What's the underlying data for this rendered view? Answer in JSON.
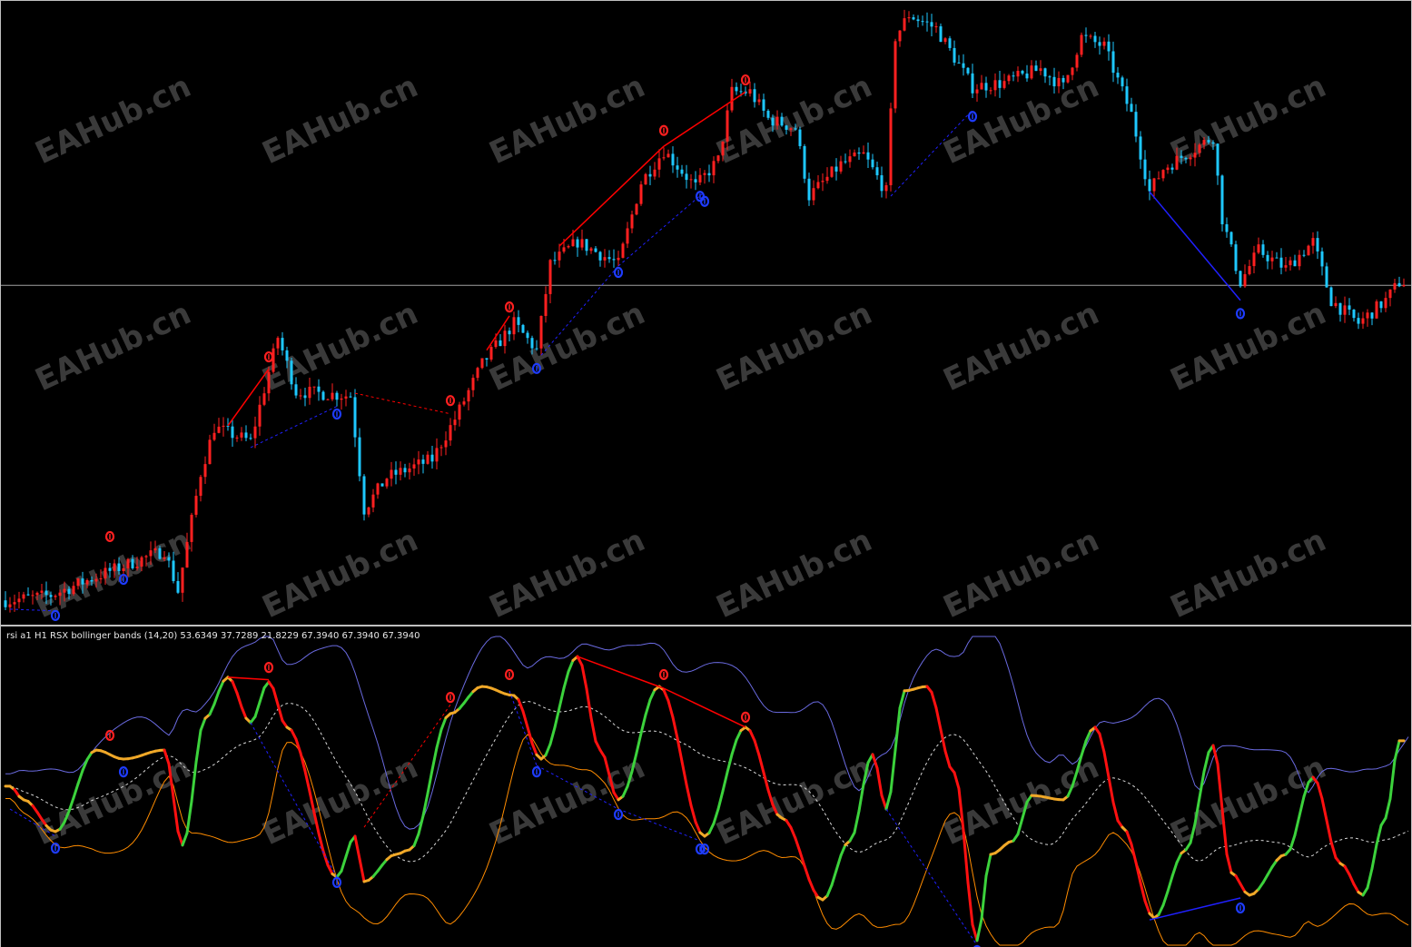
{
  "chart_data": [
    {
      "type": "candlestick",
      "title": "",
      "symbol_timeframe": "H1",
      "price_scale_note": "relative 0-100 (no axis shown)",
      "up_color": "#ff2020",
      "down_color": "#1ec8ff",
      "bars": 310,
      "close_path": [
        [
          1,
          3.9
        ],
        [
          10,
          4.7
        ],
        [
          22,
          8.3
        ],
        [
          35,
          11.9
        ],
        [
          38,
          5.4
        ],
        [
          43,
          24.3
        ],
        [
          46,
          31.6
        ],
        [
          54,
          29.4
        ],
        [
          60,
          46.1
        ],
        [
          64,
          37.4
        ],
        [
          76,
          36.7
        ],
        [
          79,
          18.5
        ],
        [
          84,
          23.6
        ],
        [
          94,
          26.5
        ],
        [
          99,
          33.0
        ],
        [
          105,
          41.8
        ],
        [
          112,
          48.3
        ],
        [
          117,
          44.0
        ],
        [
          120,
          57.8
        ],
        [
          126,
          61.4
        ],
        [
          135,
          57.8
        ],
        [
          140,
          70.9
        ],
        [
          145,
          76.0
        ],
        [
          152,
          70.2
        ],
        [
          157,
          74.5
        ],
        [
          160,
          85.4
        ],
        [
          164,
          85.4
        ],
        [
          168,
          81.1
        ],
        [
          174,
          79.6
        ],
        [
          177,
          68.7
        ],
        [
          184,
          73.8
        ],
        [
          189,
          75.3
        ],
        [
          194,
          69.4
        ],
        [
          196,
          94.2
        ],
        [
          199,
          97.8
        ],
        [
          205,
          95.6
        ],
        [
          213,
          86.2
        ],
        [
          220,
          86.9
        ],
        [
          228,
          89.1
        ],
        [
          233,
          86.2
        ],
        [
          237,
          94.2
        ],
        [
          242,
          92.7
        ],
        [
          248,
          81.8
        ],
        [
          252,
          69.4
        ],
        [
          255,
          73.1
        ],
        [
          266,
          78.2
        ],
        [
          268,
          65.1
        ],
        [
          272,
          54.9
        ],
        [
          276,
          60.0
        ],
        [
          282,
          57.1
        ],
        [
          288,
          61.4
        ],
        [
          292,
          52.0
        ],
        [
          298,
          48.3
        ],
        [
          304,
          52.0
        ],
        [
          307,
          54.9
        ]
      ],
      "horizontal_line": 54.4,
      "divergence_lines": [
        {
          "color": "#ff0000",
          "style": "solid",
          "from": [
            49,
            31.9
          ],
          "to": [
            58,
            41.0
          ]
        },
        {
          "color": "#ff0000",
          "style": "solid",
          "from": [
            106,
            44.0
          ],
          "to": [
            111,
            49.5
          ]
        },
        {
          "color": "#ff0000",
          "style": "solid",
          "from": [
            122,
            60.7
          ],
          "to": [
            145,
            76.7
          ]
        },
        {
          "color": "#ff0000",
          "style": "solid",
          "from": [
            145,
            76.7
          ],
          "to": [
            163,
            85.4
          ]
        },
        {
          "color": "#ff0000",
          "style": "dashed",
          "from": [
            77,
            37.1
          ],
          "to": [
            98,
            33.8
          ]
        },
        {
          "color": "#2020ff",
          "style": "dashed",
          "from": [
            1,
            2.5
          ],
          "to": [
            11,
            2.2
          ]
        },
        {
          "color": "#2020ff",
          "style": "dashed",
          "from": [
            54,
            28.4
          ],
          "to": [
            73,
            35.0
          ]
        },
        {
          "color": "#2020ff",
          "style": "dashed",
          "from": [
            118,
            43.2
          ],
          "to": [
            135,
            57.5
          ]
        },
        {
          "color": "#2020ff",
          "style": "dashed",
          "from": [
            135,
            57.5
          ],
          "to": [
            154,
            69.4
          ]
        },
        {
          "color": "#2020ff",
          "style": "dashed",
          "from": [
            195,
            68.7
          ],
          "to": [
            213,
            82.5
          ]
        },
        {
          "color": "#2020ff",
          "style": "solid",
          "from": [
            252,
            69.4
          ],
          "to": [
            272,
            52.0
          ]
        }
      ],
      "sell_markers": [
        [
          23,
          13.4
        ],
        [
          58,
          42.2
        ],
        [
          98,
          35.2
        ],
        [
          111,
          50.2
        ],
        [
          145,
          78.5
        ],
        [
          163,
          86.6
        ]
      ],
      "buy_markers": [
        [
          11,
          2.2
        ],
        [
          26,
          8.0
        ],
        [
          73,
          34.5
        ],
        [
          117,
          41.8
        ],
        [
          135,
          57.2
        ],
        [
          153,
          69.4
        ],
        [
          154,
          68.6
        ],
        [
          213,
          82.2
        ],
        [
          272,
          50.6
        ]
      ]
    },
    {
      "type": "line",
      "title": "rsi a1 H1 RSX bollinger bands (14,20) 53.6349 37.7289 21.8229 67.3940 67.3940 67.3940",
      "ylim": [
        0,
        100
      ],
      "colors": {
        "up": "#3cd23c",
        "down": "#ff1010",
        "flat": "#f0a828",
        "upper_band": "#6a6ae0",
        "middle_band": "#d8d8d8",
        "lower_band": "#ff8c00"
      },
      "rsx_path": [
        [
          1,
          51.5
        ],
        [
          4,
          47.1
        ],
        [
          11,
          36.8
        ],
        [
          20,
          63.2
        ],
        [
          26,
          60.3
        ],
        [
          35,
          63.2
        ],
        [
          39,
          32.4
        ],
        [
          44,
          73.5
        ],
        [
          49,
          86.8
        ],
        [
          54,
          72.1
        ],
        [
          58,
          85.3
        ],
        [
          62,
          70.6
        ],
        [
          73,
          22.1
        ],
        [
          77,
          35.3
        ],
        [
          79,
          20.6
        ],
        [
          86,
          29.4
        ],
        [
          89,
          30.9
        ],
        [
          98,
          75.0
        ],
        [
          105,
          83.8
        ],
        [
          112,
          80.9
        ],
        [
          118,
          60.3
        ],
        [
          126,
          93.5
        ],
        [
          131,
          63.2
        ],
        [
          135,
          47.1
        ],
        [
          144,
          83.8
        ],
        [
          154,
          35.3
        ],
        [
          163,
          70.6
        ],
        [
          171,
          41.2
        ],
        [
          180,
          14.7
        ],
        [
          186,
          33.8
        ],
        [
          191,
          61.8
        ],
        [
          194,
          44.1
        ],
        [
          198,
          82.4
        ],
        [
          203,
          83.8
        ],
        [
          209,
          55.9
        ],
        [
          214,
          1.5
        ],
        [
          217,
          29.4
        ],
        [
          222,
          33.8
        ],
        [
          226,
          48.5
        ],
        [
          233,
          47.1
        ],
        [
          240,
          70.6
        ],
        [
          246,
          38.2
        ],
        [
          253,
          8.8
        ],
        [
          260,
          30.9
        ],
        [
          266,
          64.7
        ],
        [
          270,
          23.5
        ],
        [
          274,
          16.2
        ],
        [
          282,
          29.4
        ],
        [
          288,
          54.4
        ],
        [
          294,
          26.5
        ],
        [
          299,
          16.2
        ],
        [
          304,
          41.2
        ],
        [
          307,
          66.2
        ]
      ],
      "divergence_lines": [
        {
          "color": "#ff0000",
          "style": "solid",
          "from": [
            49,
            86.8
          ],
          "to": [
            58,
            86.0
          ]
        },
        {
          "color": "#ff0000",
          "style": "solid",
          "from": [
            126,
            93.5
          ],
          "to": [
            145,
            83.2
          ]
        },
        {
          "color": "#ff0000",
          "style": "solid",
          "from": [
            145,
            83.2
          ],
          "to": [
            163,
            70.6
          ]
        },
        {
          "color": "#ff0000",
          "style": "dashed",
          "from": [
            79,
            38.2
          ],
          "to": [
            98,
            77.9
          ]
        },
        {
          "color": "#2020ff",
          "style": "dashed",
          "from": [
            1,
            44.1
          ],
          "to": [
            11,
            35.3
          ]
        },
        {
          "color": "#2020ff",
          "style": "dashed",
          "from": [
            54,
            72.1
          ],
          "to": [
            73,
            22.1
          ]
        },
        {
          "color": "#2020ff",
          "style": "dashed",
          "from": [
            111,
            82.4
          ],
          "to": [
            117,
            58.2
          ]
        },
        {
          "color": "#2020ff",
          "style": "dashed",
          "from": [
            117,
            58.2
          ],
          "to": [
            135,
            44.1
          ]
        },
        {
          "color": "#2020ff",
          "style": "dashed",
          "from": [
            135,
            44.1
          ],
          "to": [
            153,
            33.8
          ]
        },
        {
          "color": "#2020ff",
          "style": "dashed",
          "from": [
            194,
            44.1
          ],
          "to": [
            214,
            0
          ]
        },
        {
          "color": "#2020ff",
          "style": "solid",
          "from": [
            252,
            8.2
          ],
          "to": [
            272,
            15.3
          ]
        }
      ],
      "sell_markers": [
        [
          23,
          66.2
        ],
        [
          58,
          88.2
        ],
        [
          98,
          78.5
        ],
        [
          111,
          85.9
        ],
        [
          145,
          85.9
        ],
        [
          163,
          72.1
        ]
      ],
      "buy_markers": [
        [
          11,
          33.2
        ],
        [
          26,
          57.9
        ],
        [
          73,
          22.1
        ],
        [
          117,
          57.9
        ],
        [
          135,
          44.1
        ],
        [
          153,
          32.9
        ],
        [
          154,
          32.9
        ],
        [
          214,
          0
        ],
        [
          272,
          13.8
        ]
      ]
    }
  ],
  "watermark": "EAHub.cn",
  "indicator_label": "rsi a1 H1 RSX bollinger bands (14,20) 53.6349 37.7289 21.8229 67.3940 67.3940 67.3940"
}
